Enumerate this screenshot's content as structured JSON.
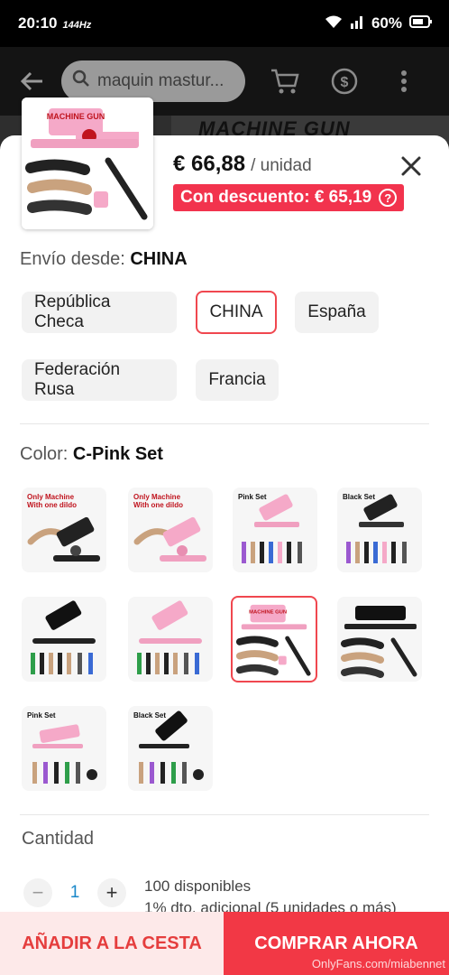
{
  "status": {
    "time": "20:10",
    "refresh": "144",
    "refresh_unit": "Hz",
    "battery": "60%"
  },
  "header": {
    "search_text": "maquin mastur...",
    "banner_text": "MACHINE GUN"
  },
  "product": {
    "price": "€ 66,88",
    "unit": "/ unidad",
    "discount_label": "Con descuento: € 65,19",
    "discount_info": "?"
  },
  "shipping": {
    "label": "Envío desde:",
    "value": "CHINA",
    "options": [
      "República Checa",
      "CHINA",
      "España",
      "Federación Rusa",
      "Francia"
    ],
    "selected": "CHINA"
  },
  "color": {
    "label": "Color:",
    "value": "C-Pink Set",
    "swatch_tags": [
      "Only Machine With one dildo",
      "Only Machine With one dildo",
      "Pink Set",
      "Black Set",
      "",
      "",
      "MACHINE GUN",
      "",
      "Pink Set",
      "Black Set"
    ],
    "selected_index": 6
  },
  "quantity": {
    "label": "Cantidad",
    "value": "1",
    "minus": "−",
    "plus": "+",
    "available": "100 disponibles",
    "bulk_discount": "1% dto. adicional (5 unidades o más)"
  },
  "actions": {
    "add_to_cart": "AÑADIR A LA CESTA",
    "buy_now": "COMPRAR AHORA"
  },
  "watermark": "OnlyFans.com/miabennet",
  "colors": {
    "accent": "#f23845",
    "selected_border": "#f0474f",
    "qty_blue": "#1a88c9",
    "pink": "#f5a9c8"
  }
}
